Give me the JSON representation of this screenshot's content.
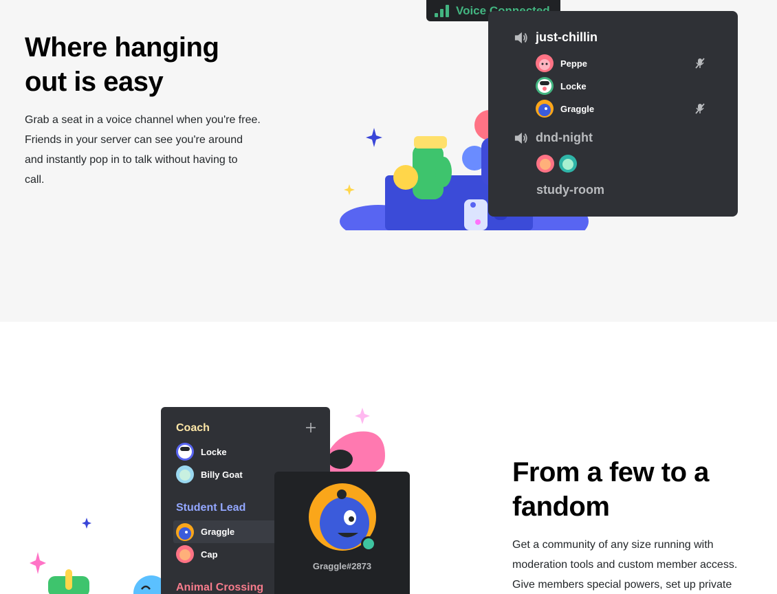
{
  "section1": {
    "heading_line1": "Where hanging",
    "heading_line2": "out is easy",
    "body_lines": [
      "Grab a seat in a voice channel when you're free.",
      "Friends in your server can see you're around",
      "and instantly pop in to talk without having to",
      "call."
    ],
    "voice_badge": "Voice Connected",
    "channels": [
      {
        "name": "just-chillin",
        "members": [
          "Peppe",
          "Locke",
          "Graggle"
        ]
      },
      {
        "name": "dnd-night"
      },
      {
        "name": "study-room"
      }
    ]
  },
  "section2": {
    "heading_line1": "From a few to a",
    "heading_line2": "fandom",
    "body_lines": [
      "Get a community of any size running with",
      "moderation tools and custom member access.",
      "Give members special powers, set up private"
    ],
    "roles": [
      {
        "title": "Coach",
        "members": [
          "Locke",
          "Billy Goat"
        ]
      },
      {
        "title": "Student Lead",
        "members": [
          "Graggle",
          "Cap"
        ]
      },
      {
        "title": "Animal Crossing"
      }
    ],
    "profile_tag": "Graggle#2873"
  },
  "colors": {
    "accent_green": "#43b581",
    "panel_dark": "#2f3136",
    "coach_color": "#ffe8a8",
    "student_lead_color": "#93a7ff",
    "animal_crossing_color": "#f77c8c"
  }
}
